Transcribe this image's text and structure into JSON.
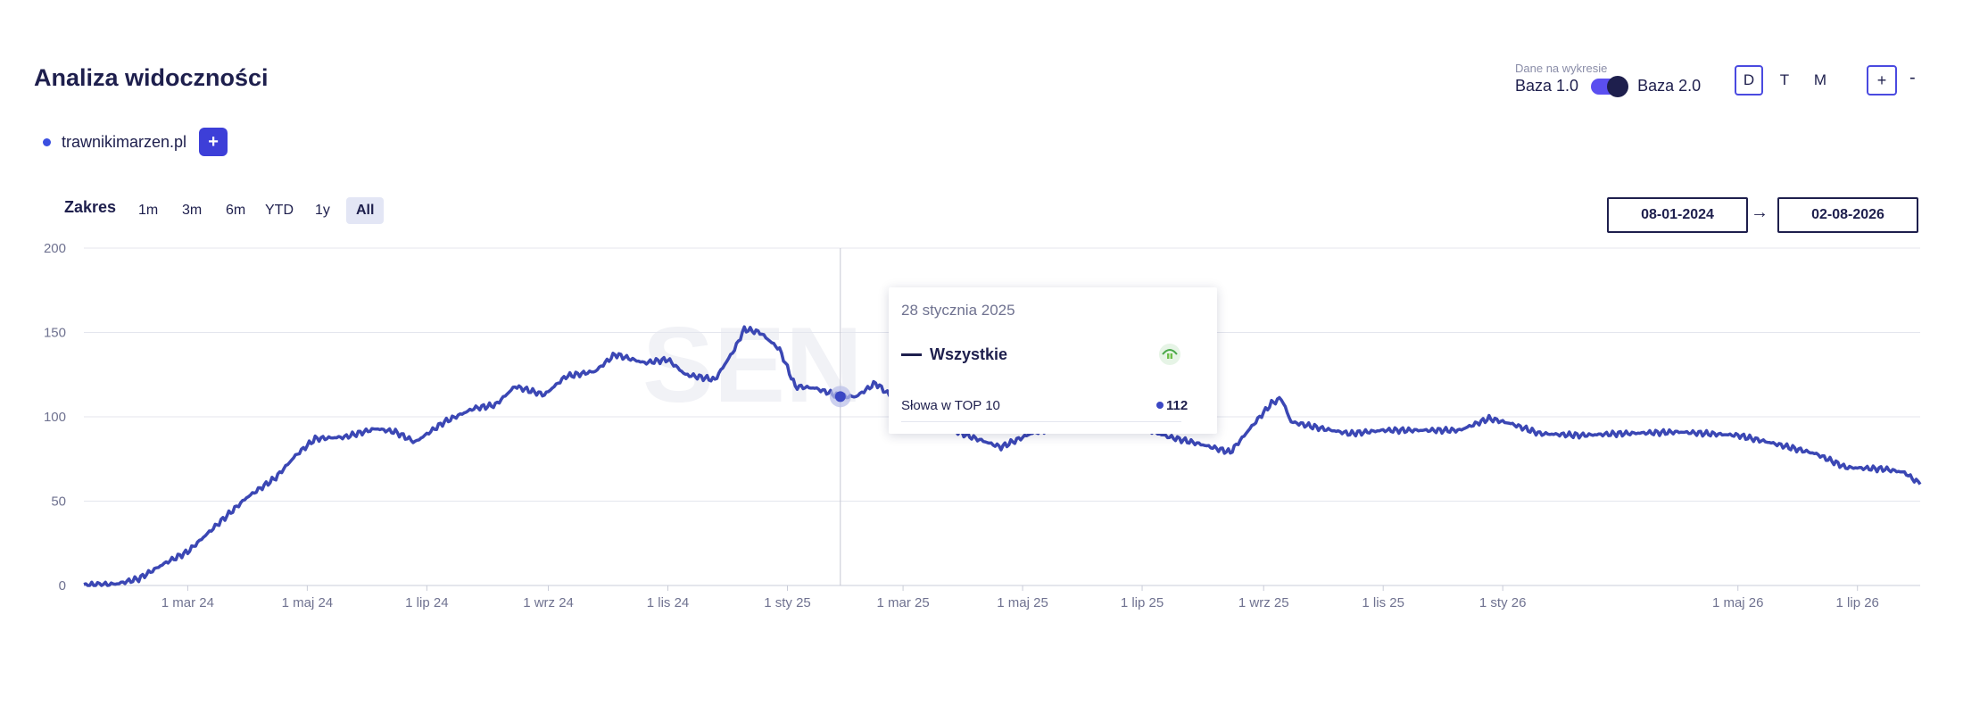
{
  "header": {
    "title": "Analiza widoczności"
  },
  "legend": {
    "domain": "trawnikimarzen.pl",
    "add_label": "+"
  },
  "base_toggle": {
    "caption": "Dane na wykresie",
    "left_label": "Baza 1.0",
    "right_label": "Baza 2.0",
    "selected": "Baza 2.0"
  },
  "period_buttons": [
    "D",
    "T",
    "M"
  ],
  "period_selected": "D",
  "zoom": {
    "plus": "+",
    "minus": "-"
  },
  "range": {
    "label": "Zakres",
    "options": [
      "1m",
      "3m",
      "6m",
      "YTD",
      "1y",
      "All"
    ],
    "selected": "All"
  },
  "dates": {
    "from": "08-01-2024",
    "arrow": "→",
    "to": "02-08-2026"
  },
  "tooltip": {
    "date": "28 stycznia 2025",
    "series": "Wszystkie",
    "metric_label": "Słowa w TOP 10",
    "metric_value": "112"
  },
  "colors": {
    "line": "#3b47b4",
    "accent": "#3d3fd8",
    "title": "#1e1f4d",
    "grid": "#e4e6ee"
  },
  "chart_data": {
    "type": "line",
    "title": "",
    "xlabel": "",
    "ylabel": "",
    "ylim": [
      0,
      200
    ],
    "yticks": [
      0,
      50,
      100,
      150,
      200
    ],
    "xlim": [
      "2024-01-08",
      "2026-08-02"
    ],
    "xticks": [
      {
        "date": "2024-03-01",
        "label": "1 mar 24"
      },
      {
        "date": "2024-05-01",
        "label": "1 maj 24"
      },
      {
        "date": "2024-07-01",
        "label": "1 lip 24"
      },
      {
        "date": "2024-09-01",
        "label": "1 wrz 24"
      },
      {
        "date": "2024-11-01",
        "label": "1 lis 24"
      },
      {
        "date": "2025-01-01",
        "label": "1 sty 25"
      },
      {
        "date": "2025-03-01",
        "label": "1 mar 25"
      },
      {
        "date": "2025-05-01",
        "label": "1 maj 25"
      },
      {
        "date": "2025-07-01",
        "label": "1 lip 25"
      },
      {
        "date": "2025-09-01",
        "label": "1 wrz 25"
      },
      {
        "date": "2025-11-01",
        "label": "1 lis 25"
      },
      {
        "date": "2026-01-01",
        "label": "1 sty 26"
      },
      {
        "date": "2026-05-01",
        "label": "1 maj 26"
      },
      {
        "date": "2026-07-01",
        "label": "1 lip 26"
      }
    ],
    "grid": true,
    "legend": "none",
    "watermark": "SEN",
    "series": [
      {
        "name": "Wszystkie",
        "points": [
          [
            "2024-01-08",
            0
          ],
          [
            "2024-01-25",
            1
          ],
          [
            "2024-02-05",
            4
          ],
          [
            "2024-02-18",
            13
          ],
          [
            "2024-03-01",
            20
          ],
          [
            "2024-03-15",
            35
          ],
          [
            "2024-03-31",
            52
          ],
          [
            "2024-04-15",
            64
          ],
          [
            "2024-04-25",
            77
          ],
          [
            "2024-05-05",
            87
          ],
          [
            "2024-05-20",
            88
          ],
          [
            "2024-06-05",
            93
          ],
          [
            "2024-06-15",
            91
          ],
          [
            "2024-06-25",
            85
          ],
          [
            "2024-07-10",
            97
          ],
          [
            "2024-07-25",
            105
          ],
          [
            "2024-08-05",
            107
          ],
          [
            "2024-08-15",
            118
          ],
          [
            "2024-08-30",
            113
          ],
          [
            "2024-09-10",
            124
          ],
          [
            "2024-09-25",
            127
          ],
          [
            "2024-10-05",
            137
          ],
          [
            "2024-10-20",
            132
          ],
          [
            "2024-11-01",
            134
          ],
          [
            "2024-11-10",
            125
          ],
          [
            "2024-11-25",
            122
          ],
          [
            "2024-12-05",
            140
          ],
          [
            "2024-12-10",
            152
          ],
          [
            "2024-12-18",
            150
          ],
          [
            "2024-12-28",
            140
          ],
          [
            "2025-01-05",
            118
          ],
          [
            "2025-01-15",
            117
          ],
          [
            "2025-01-28",
            112
          ],
          [
            "2025-02-05",
            112
          ],
          [
            "2025-02-15",
            120
          ],
          [
            "2025-02-25",
            110
          ],
          [
            "2025-03-10",
            100
          ],
          [
            "2025-03-20",
            95
          ],
          [
            "2025-04-05",
            88
          ],
          [
            "2025-04-20",
            82
          ],
          [
            "2025-05-05",
            90
          ],
          [
            "2025-05-25",
            95
          ],
          [
            "2025-06-15",
            97
          ],
          [
            "2025-07-01",
            93
          ],
          [
            "2025-07-15",
            88
          ],
          [
            "2025-07-30",
            84
          ],
          [
            "2025-08-15",
            79
          ],
          [
            "2025-08-25",
            93
          ],
          [
            "2025-09-05",
            108
          ],
          [
            "2025-09-10",
            111
          ],
          [
            "2025-09-15",
            97
          ],
          [
            "2025-10-01",
            93
          ],
          [
            "2025-10-15",
            90
          ],
          [
            "2025-11-01",
            92
          ],
          [
            "2025-11-20",
            92
          ],
          [
            "2025-12-10",
            92
          ],
          [
            "2025-12-25",
            99
          ],
          [
            "2026-01-05",
            96
          ],
          [
            "2026-01-20",
            90
          ],
          [
            "2026-02-10",
            89
          ],
          [
            "2026-03-01",
            90
          ],
          [
            "2026-04-01",
            91
          ],
          [
            "2026-05-01",
            89
          ],
          [
            "2026-05-20",
            84
          ],
          [
            "2026-06-10",
            78
          ],
          [
            "2026-06-25",
            70
          ],
          [
            "2026-07-15",
            69
          ],
          [
            "2026-07-25",
            67
          ],
          [
            "2026-08-02",
            60
          ]
        ]
      }
    ],
    "hover": {
      "date": "2025-01-28",
      "value": 112
    }
  }
}
